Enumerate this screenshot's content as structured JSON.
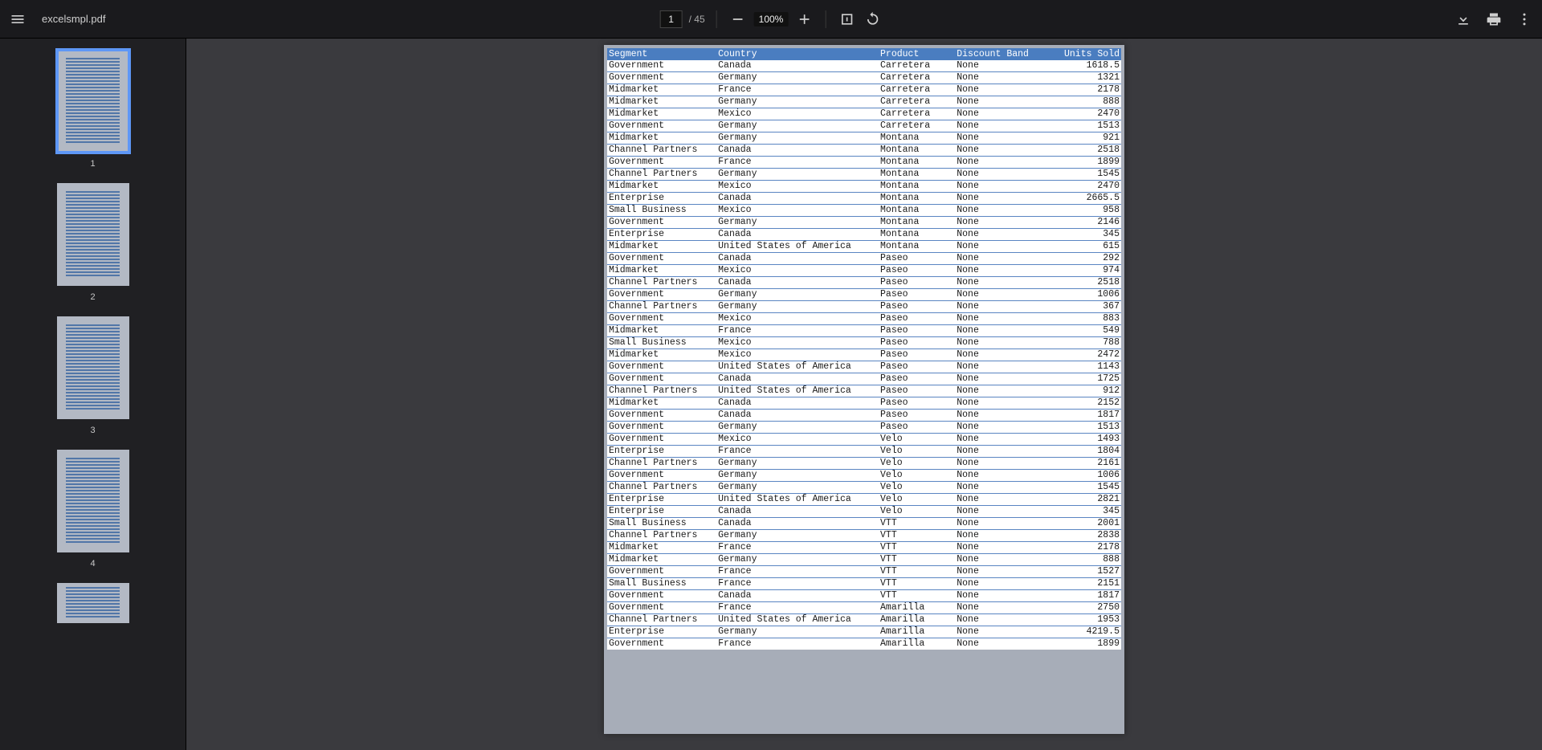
{
  "toolbar": {
    "filename": "excelsmpl.pdf",
    "current_page": "1",
    "total_pages": "/ 45",
    "zoom": "100%"
  },
  "thumbnails": {
    "labels": [
      "1",
      "2",
      "3",
      "4"
    ]
  },
  "table": {
    "headers": {
      "segment": "Segment",
      "country": "Country",
      "product": "Product",
      "discount_band": "Discount Band",
      "units_sold": "Units Sold"
    },
    "rows": [
      {
        "segment": "Government",
        "country": "Canada",
        "product": "Carretera",
        "discount_band": "None",
        "units_sold": "1618.5"
      },
      {
        "segment": "Government",
        "country": "Germany",
        "product": "Carretera",
        "discount_band": "None",
        "units_sold": "1321"
      },
      {
        "segment": "Midmarket",
        "country": "France",
        "product": "Carretera",
        "discount_band": "None",
        "units_sold": "2178"
      },
      {
        "segment": "Midmarket",
        "country": "Germany",
        "product": "Carretera",
        "discount_band": "None",
        "units_sold": "888"
      },
      {
        "segment": "Midmarket",
        "country": "Mexico",
        "product": "Carretera",
        "discount_band": "None",
        "units_sold": "2470"
      },
      {
        "segment": "Government",
        "country": "Germany",
        "product": "Carretera",
        "discount_band": "None",
        "units_sold": "1513"
      },
      {
        "segment": "Midmarket",
        "country": "Germany",
        "product": "Montana",
        "discount_band": "None",
        "units_sold": "921"
      },
      {
        "segment": "Channel Partners",
        "country": "Canada",
        "product": "Montana",
        "discount_band": "None",
        "units_sold": "2518"
      },
      {
        "segment": "Government",
        "country": "France",
        "product": "Montana",
        "discount_band": "None",
        "units_sold": "1899"
      },
      {
        "segment": "Channel Partners",
        "country": "Germany",
        "product": "Montana",
        "discount_band": "None",
        "units_sold": "1545"
      },
      {
        "segment": "Midmarket",
        "country": "Mexico",
        "product": "Montana",
        "discount_band": "None",
        "units_sold": "2470"
      },
      {
        "segment": "Enterprise",
        "country": "Canada",
        "product": "Montana",
        "discount_band": "None",
        "units_sold": "2665.5"
      },
      {
        "segment": "Small Business",
        "country": "Mexico",
        "product": "Montana",
        "discount_band": "None",
        "units_sold": "958"
      },
      {
        "segment": "Government",
        "country": "Germany",
        "product": "Montana",
        "discount_band": "None",
        "units_sold": "2146"
      },
      {
        "segment": "Enterprise",
        "country": "Canada",
        "product": "Montana",
        "discount_band": "None",
        "units_sold": "345"
      },
      {
        "segment": "Midmarket",
        "country": "United States of America",
        "product": "Montana",
        "discount_band": "None",
        "units_sold": "615"
      },
      {
        "segment": "Government",
        "country": "Canada",
        "product": "Paseo",
        "discount_band": "None",
        "units_sold": "292"
      },
      {
        "segment": "Midmarket",
        "country": "Mexico",
        "product": "Paseo",
        "discount_band": "None",
        "units_sold": "974"
      },
      {
        "segment": "Channel Partners",
        "country": "Canada",
        "product": "Paseo",
        "discount_band": "None",
        "units_sold": "2518"
      },
      {
        "segment": "Government",
        "country": "Germany",
        "product": "Paseo",
        "discount_band": "None",
        "units_sold": "1006"
      },
      {
        "segment": "Channel Partners",
        "country": "Germany",
        "product": "Paseo",
        "discount_band": "None",
        "units_sold": "367"
      },
      {
        "segment": "Government",
        "country": "Mexico",
        "product": "Paseo",
        "discount_band": "None",
        "units_sold": "883"
      },
      {
        "segment": "Midmarket",
        "country": "France",
        "product": "Paseo",
        "discount_band": "None",
        "units_sold": "549"
      },
      {
        "segment": "Small Business",
        "country": "Mexico",
        "product": "Paseo",
        "discount_band": "None",
        "units_sold": "788"
      },
      {
        "segment": "Midmarket",
        "country": "Mexico",
        "product": "Paseo",
        "discount_band": "None",
        "units_sold": "2472"
      },
      {
        "segment": "Government",
        "country": "United States of America",
        "product": "Paseo",
        "discount_band": "None",
        "units_sold": "1143"
      },
      {
        "segment": "Government",
        "country": "Canada",
        "product": "Paseo",
        "discount_band": "None",
        "units_sold": "1725"
      },
      {
        "segment": "Channel Partners",
        "country": "United States of America",
        "product": "Paseo",
        "discount_band": "None",
        "units_sold": "912"
      },
      {
        "segment": "Midmarket",
        "country": "Canada",
        "product": "Paseo",
        "discount_band": "None",
        "units_sold": "2152"
      },
      {
        "segment": "Government",
        "country": "Canada",
        "product": "Paseo",
        "discount_band": "None",
        "units_sold": "1817"
      },
      {
        "segment": "Government",
        "country": "Germany",
        "product": "Paseo",
        "discount_band": "None",
        "units_sold": "1513"
      },
      {
        "segment": "Government",
        "country": "Mexico",
        "product": "Velo",
        "discount_band": "None",
        "units_sold": "1493"
      },
      {
        "segment": "Enterprise",
        "country": "France",
        "product": "Velo",
        "discount_band": "None",
        "units_sold": "1804"
      },
      {
        "segment": "Channel Partners",
        "country": "Germany",
        "product": "Velo",
        "discount_band": "None",
        "units_sold": "2161"
      },
      {
        "segment": "Government",
        "country": "Germany",
        "product": "Velo",
        "discount_band": "None",
        "units_sold": "1006"
      },
      {
        "segment": "Channel Partners",
        "country": "Germany",
        "product": "Velo",
        "discount_band": "None",
        "units_sold": "1545"
      },
      {
        "segment": "Enterprise",
        "country": "United States of America",
        "product": "Velo",
        "discount_band": "None",
        "units_sold": "2821"
      },
      {
        "segment": "Enterprise",
        "country": "Canada",
        "product": "Velo",
        "discount_band": "None",
        "units_sold": "345"
      },
      {
        "segment": "Small Business",
        "country": "Canada",
        "product": "VTT",
        "discount_band": "None",
        "units_sold": "2001"
      },
      {
        "segment": "Channel Partners",
        "country": "Germany",
        "product": "VTT",
        "discount_band": "None",
        "units_sold": "2838"
      },
      {
        "segment": "Midmarket",
        "country": "France",
        "product": "VTT",
        "discount_band": "None",
        "units_sold": "2178"
      },
      {
        "segment": "Midmarket",
        "country": "Germany",
        "product": "VTT",
        "discount_band": "None",
        "units_sold": "888"
      },
      {
        "segment": "Government",
        "country": "France",
        "product": "VTT",
        "discount_band": "None",
        "units_sold": "1527"
      },
      {
        "segment": "Small Business",
        "country": "France",
        "product": "VTT",
        "discount_band": "None",
        "units_sold": "2151"
      },
      {
        "segment": "Government",
        "country": "Canada",
        "product": "VTT",
        "discount_band": "None",
        "units_sold": "1817"
      },
      {
        "segment": "Government",
        "country": "France",
        "product": "Amarilla",
        "discount_band": "None",
        "units_sold": "2750"
      },
      {
        "segment": "Channel Partners",
        "country": "United States of America",
        "product": "Amarilla",
        "discount_band": "None",
        "units_sold": "1953"
      },
      {
        "segment": "Enterprise",
        "country": "Germany",
        "product": "Amarilla",
        "discount_band": "None",
        "units_sold": "4219.5"
      },
      {
        "segment": "Government",
        "country": "France",
        "product": "Amarilla",
        "discount_band": "None",
        "units_sold": "1899"
      }
    ]
  }
}
